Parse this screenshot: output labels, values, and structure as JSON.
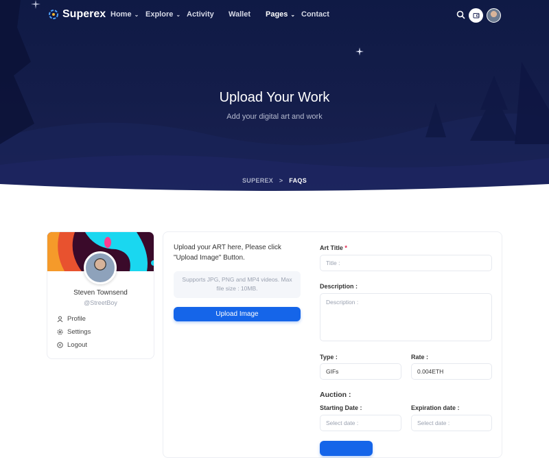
{
  "brand": {
    "name": "Superex"
  },
  "nav": {
    "items": [
      {
        "label": "Home",
        "dropdown": true
      },
      {
        "label": "Explore",
        "dropdown": true
      },
      {
        "label": "Activity"
      },
      {
        "label": "Wallet"
      },
      {
        "label": "Pages",
        "dropdown": true,
        "active": true
      },
      {
        "label": "Contact"
      }
    ],
    "icons": [
      "search-icon",
      "wallet-icon",
      "user-avatar"
    ]
  },
  "hero": {
    "title": "Upload Your Work",
    "subtitle": "Add your digital art and work",
    "breadcrumb": [
      "SUPEREX",
      "FAQS"
    ],
    "separator": ">"
  },
  "profile": {
    "name": "Steven Townsend",
    "handle": "@StreetBoy",
    "links": [
      {
        "label": "Profile",
        "icon": "user-icon"
      },
      {
        "label": "Settings",
        "icon": "gear-icon"
      },
      {
        "label": "Logout",
        "icon": "logout-icon"
      }
    ]
  },
  "upload": {
    "instructions": "Upload your ART here, Please click \"Upload Image\" Button.",
    "support": "Supports JPG, PNG and MP4 videos. Max file size : 10MB.",
    "button": "Upload Image"
  },
  "form": {
    "art_title": {
      "label": "Art Title",
      "required": "*",
      "placeholder": "Title :"
    },
    "description": {
      "label": "Description :",
      "placeholder": "Description :"
    },
    "type": {
      "label": "Type :",
      "value": "GIFs"
    },
    "rate": {
      "label": "Rate :",
      "value": "0.004ETH"
    },
    "auction": {
      "label": "Auction :"
    },
    "start": {
      "label": "Starting Date :",
      "placeholder": "Select date :"
    },
    "end": {
      "label": "Expiration date :",
      "placeholder": "Select date :"
    }
  },
  "colors": {
    "primary": "#1565e9",
    "hero": "#141d4a"
  }
}
